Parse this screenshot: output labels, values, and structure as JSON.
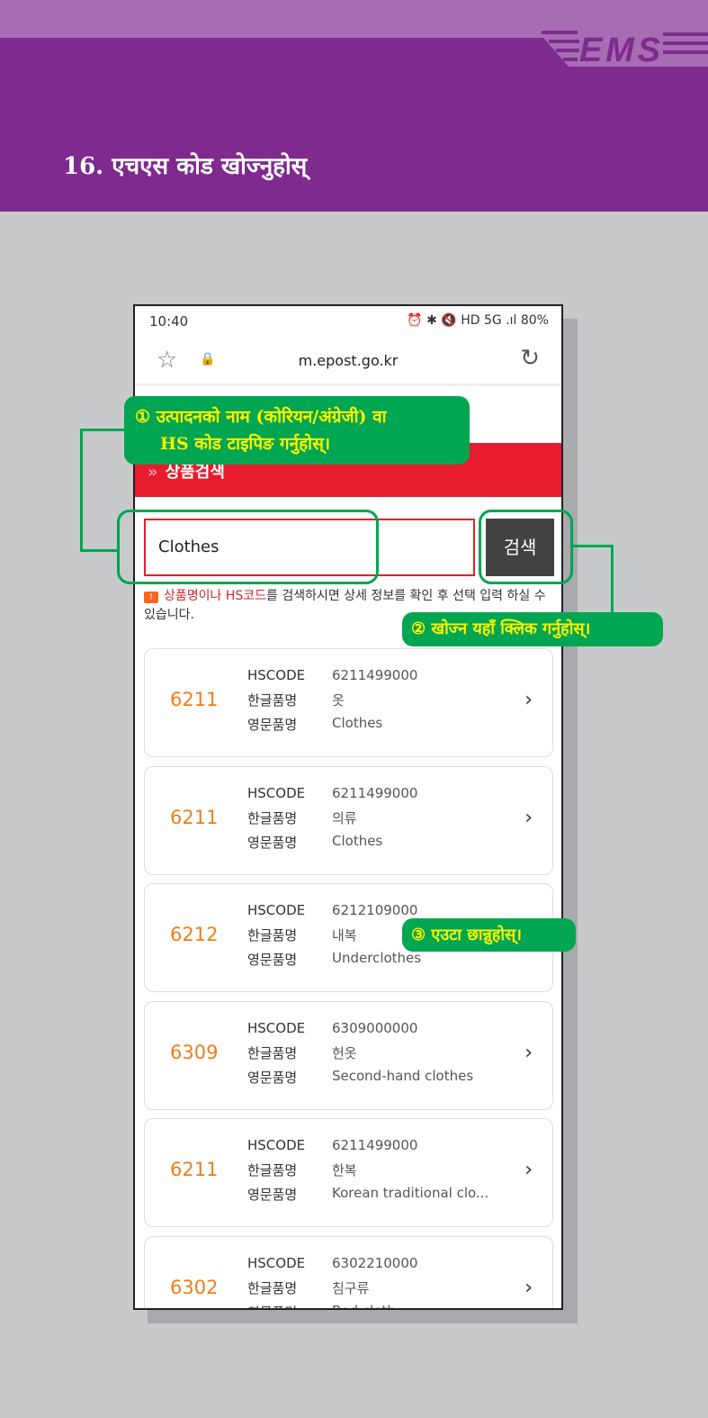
{
  "header": {
    "title": "16. एचएस कोड खोज्नुहोस्",
    "logo": "EMS"
  },
  "colors": {
    "purple": "#7f2a8e",
    "accent_red": "#e81c2e",
    "callout_green": "#00a651",
    "callout_text": "#fff200",
    "code_orange": "#f07d1a"
  },
  "phone": {
    "status": {
      "time": "10:40",
      "right": "⏰ ✱ 🔇 HD 5G .ıl 80%"
    },
    "browser": {
      "url": "m.epost.go.kr",
      "star_icon": "star-icon",
      "lock_icon": "lock-icon",
      "reload_icon": "reload-icon"
    },
    "banner": {
      "title": "상품검색"
    },
    "search": {
      "value": "Clothes",
      "button": "검색"
    },
    "hint": {
      "red_part1": "상품명",
      "plain1": "이나 ",
      "red_part2": "HS코드",
      "plain2": "를 검색하시면 상세 정보를 확인 후 선택 입력 하실 수 있습니다."
    },
    "labels": {
      "hscode": "HSCODE",
      "korean": "한글품명",
      "english": "영문품명"
    },
    "results": [
      {
        "code": "6211",
        "hscode": "6211499000",
        "korean": "옷",
        "english": "Clothes"
      },
      {
        "code": "6211",
        "hscode": "6211499000",
        "korean": "의류",
        "english": "Clothes"
      },
      {
        "code": "6212",
        "hscode": "6212109000",
        "korean": "내복",
        "english": "Underclothes"
      },
      {
        "code": "6309",
        "hscode": "6309000000",
        "korean": "헌옷",
        "english": "Second-hand clothes"
      },
      {
        "code": "6211",
        "hscode": "6211499000",
        "korean": "한복",
        "english": "Korean traditional clo..."
      },
      {
        "code": "6302",
        "hscode": "6302210000",
        "korean": "침구류",
        "english": "Bed cloth"
      }
    ]
  },
  "callouts": [
    {
      "line1": "① उत्पादनको नाम (कोरियन/अंग्रेजी) वा",
      "line2": "HS कोड टाइपिङ  गर्नुहोस्।"
    },
    {
      "text": "② खोज्न यहाँ क्लिक गर्नुहोस्।"
    },
    {
      "text": "③ एउटा छान्नुहोस्।"
    }
  ]
}
